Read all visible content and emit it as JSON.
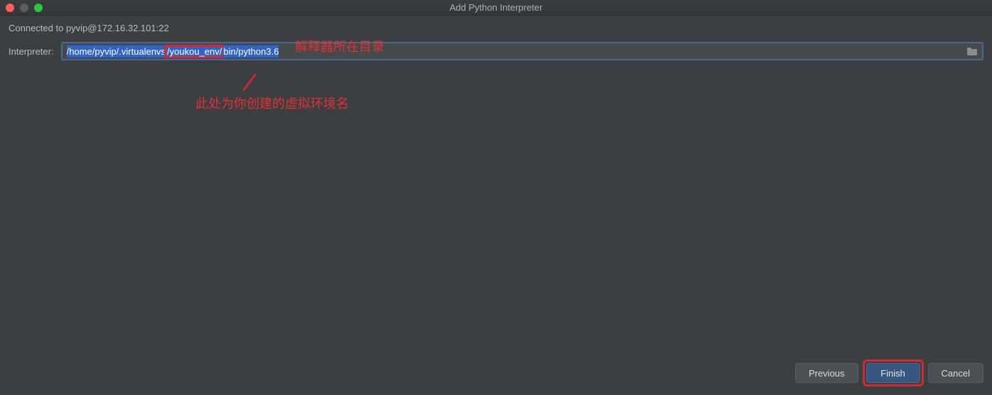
{
  "window": {
    "title": "Add Python Interpreter"
  },
  "header": {
    "connected_text": "Connected to pyvip@172.16.32.101:22"
  },
  "form": {
    "interpreter_label": "Interpreter:",
    "interpreter_path_pre": "/home/pyvip/.virtualenvs",
    "interpreter_path_env": "/youkou_env/",
    "interpreter_path_post": "bin/python3.6"
  },
  "annotations": {
    "top": "解释器所在目录",
    "bottom": "此处为你创建的虚拟环境名"
  },
  "buttons": {
    "previous": "Previous",
    "finish": "Finish",
    "cancel": "Cancel"
  }
}
